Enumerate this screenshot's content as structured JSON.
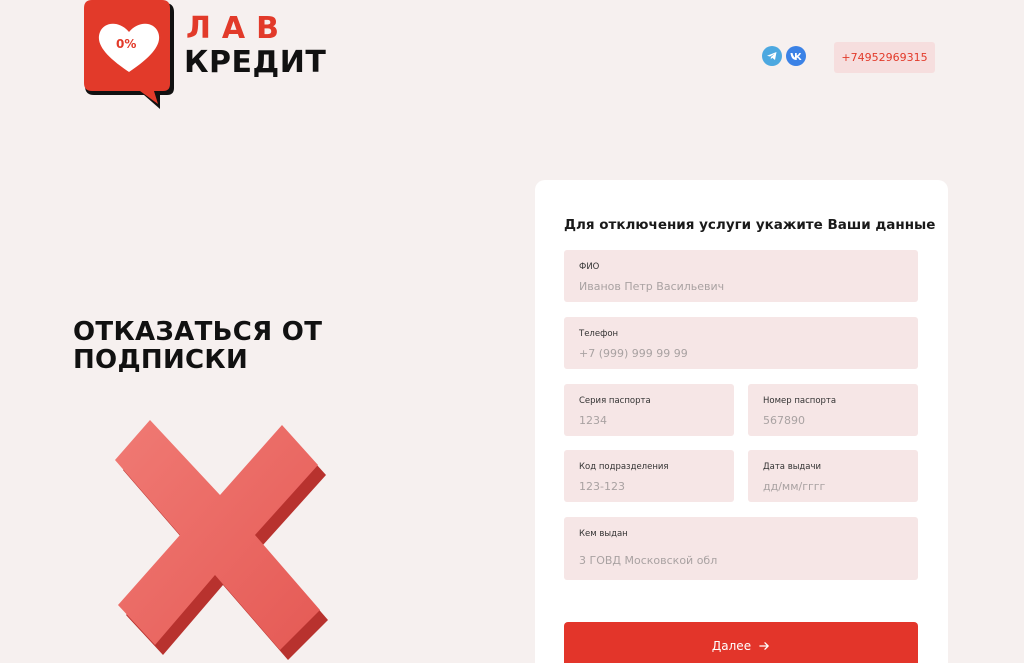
{
  "brand": {
    "badge": "0%",
    "word_top": "ЛАВ",
    "word_bottom": "КРЕДИТ",
    "accent_color": "#e23a2a"
  },
  "header": {
    "socials": [
      {
        "name": "telegram",
        "icon": "telegram-icon"
      },
      {
        "name": "vk",
        "icon": "vk-icon"
      }
    ],
    "phone": "+74952969315"
  },
  "hero": {
    "line1": "ОТКАЗАТЬСЯ ОТ",
    "line2": "ПОДПИСКИ",
    "graphic": "red-cross-icon"
  },
  "form": {
    "title": "Для отключения услуги укажите Ваши данные",
    "fields": {
      "fio": {
        "label": "ФИО",
        "placeholder": "Иванов Петр Васильевич"
      },
      "phone": {
        "label": "Телефон",
        "placeholder": "+7 (999) 999 99 99"
      },
      "passport_series": {
        "label": "Серия паспорта",
        "placeholder": "1234"
      },
      "passport_number": {
        "label": "Номер паспорта",
        "placeholder": "567890"
      },
      "division_code": {
        "label": "Код подразделения",
        "placeholder": "123-123"
      },
      "issue_date": {
        "label": "Дата выдачи",
        "placeholder": "дд/мм/гггг"
      },
      "issued_by": {
        "label": "Кем выдан",
        "placeholder": "3 ГОВД Московской обл"
      }
    },
    "submit_label": "Далее",
    "submit_icon": "arrow-right-icon"
  }
}
